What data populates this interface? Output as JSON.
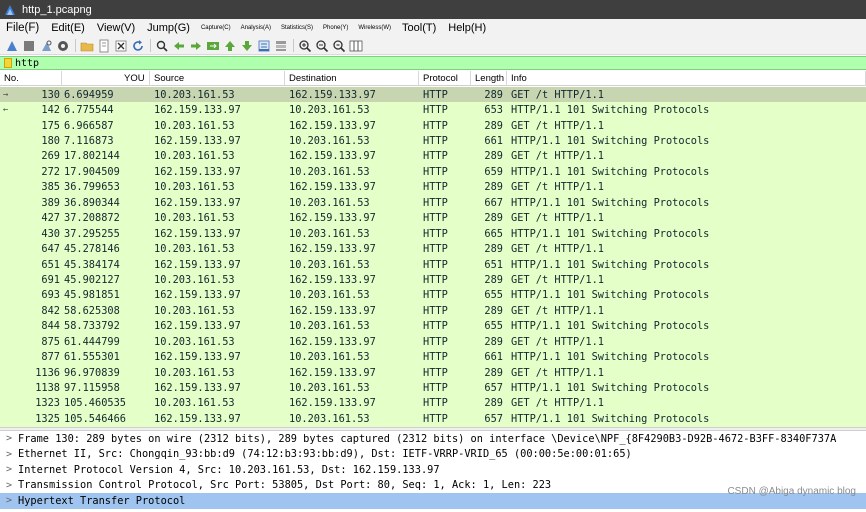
{
  "window": {
    "title": "http_1.pcapng"
  },
  "menu": {
    "items": [
      {
        "label": "File(F)",
        "size": "big"
      },
      {
        "label": "Edit(E)",
        "size": "normal"
      },
      {
        "label": "View(V)",
        "size": "normal"
      },
      {
        "label": "Jump(G)",
        "size": "normal"
      },
      {
        "label": "Capture(C)",
        "size": "small"
      },
      {
        "label": "Analysis(A)",
        "size": "small"
      },
      {
        "label": "Statistics(S)",
        "size": "small"
      },
      {
        "label": "Phone(Y)",
        "size": "small"
      },
      {
        "label": "Wireless(W)",
        "size": "small"
      },
      {
        "label": "Tool(T)",
        "size": "normal"
      },
      {
        "label": "Help(H)",
        "size": "normal"
      }
    ]
  },
  "toolbar": {
    "buttons": [
      "shark-fin-start-icon",
      "stop-icon",
      "restart-icon",
      "options-gear-icon",
      "sep",
      "open-folder-icon",
      "file-icon",
      "close-file-icon",
      "reload-icon",
      "sep",
      "find-icon",
      "go-back-icon",
      "go-forward-icon",
      "go-to-packet-icon",
      "first-packet-icon",
      "last-packet-icon",
      "autoscroll-icon",
      "colorize-icon",
      "sep",
      "zoom-in-icon",
      "zoom-out-icon",
      "zoom-normal-icon",
      "resize-columns-icon"
    ]
  },
  "filter": {
    "value": "http"
  },
  "columns": [
    "No.",
    "YOU",
    "Source",
    "Destination",
    "Protocol",
    "Length",
    "Info"
  ],
  "packets": [
    {
      "no": "130",
      "time": "6.694959",
      "src": "10.203.161.53",
      "dst": "162.159.133.97",
      "proto": "HTTP",
      "len": "289",
      "info": "GET /t HTTP/1.1",
      "arrow": "→"
    },
    {
      "no": "142",
      "time": "6.775544",
      "src": "162.159.133.97",
      "dst": "10.203.161.53",
      "proto": "HTTP",
      "len": "653",
      "info": "HTTP/1.1 101 Switching Protocols",
      "arrow": "←"
    },
    {
      "no": "175",
      "time": "6.966587",
      "src": "10.203.161.53",
      "dst": "162.159.133.97",
      "proto": "HTTP",
      "len": "289",
      "info": "GET /t HTTP/1.1",
      "arrow": ""
    },
    {
      "no": "180",
      "time": "7.116873",
      "src": "162.159.133.97",
      "dst": "10.203.161.53",
      "proto": "HTTP",
      "len": "661",
      "info": "HTTP/1.1 101 Switching Protocols",
      "arrow": ""
    },
    {
      "no": "269",
      "time": "17.802144",
      "src": "10.203.161.53",
      "dst": "162.159.133.97",
      "proto": "HTTP",
      "len": "289",
      "info": "GET /t HTTP/1.1",
      "arrow": ""
    },
    {
      "no": "272",
      "time": "17.904509",
      "src": "162.159.133.97",
      "dst": "10.203.161.53",
      "proto": "HTTP",
      "len": "659",
      "info": "HTTP/1.1 101 Switching Protocols",
      "arrow": ""
    },
    {
      "no": "385",
      "time": "36.799653",
      "src": "10.203.161.53",
      "dst": "162.159.133.97",
      "proto": "HTTP",
      "len": "289",
      "info": "GET /t HTTP/1.1",
      "arrow": ""
    },
    {
      "no": "389",
      "time": "36.890344",
      "src": "162.159.133.97",
      "dst": "10.203.161.53",
      "proto": "HTTP",
      "len": "667",
      "info": "HTTP/1.1 101 Switching Protocols",
      "arrow": ""
    },
    {
      "no": "427",
      "time": "37.208872",
      "src": "10.203.161.53",
      "dst": "162.159.133.97",
      "proto": "HTTP",
      "len": "289",
      "info": "GET /t HTTP/1.1",
      "arrow": ""
    },
    {
      "no": "430",
      "time": "37.295255",
      "src": "162.159.133.97",
      "dst": "10.203.161.53",
      "proto": "HTTP",
      "len": "665",
      "info": "HTTP/1.1 101 Switching Protocols",
      "arrow": ""
    },
    {
      "no": "647",
      "time": "45.278146",
      "src": "10.203.161.53",
      "dst": "162.159.133.97",
      "proto": "HTTP",
      "len": "289",
      "info": "GET /t HTTP/1.1",
      "arrow": ""
    },
    {
      "no": "651",
      "time": "45.384174",
      "src": "162.159.133.97",
      "dst": "10.203.161.53",
      "proto": "HTTP",
      "len": "651",
      "info": "HTTP/1.1 101 Switching Protocols",
      "arrow": ""
    },
    {
      "no": "691",
      "time": "45.902127",
      "src": "10.203.161.53",
      "dst": "162.159.133.97",
      "proto": "HTTP",
      "len": "289",
      "info": "GET /t HTTP/1.1",
      "arrow": ""
    },
    {
      "no": "693",
      "time": "45.981851",
      "src": "162.159.133.97",
      "dst": "10.203.161.53",
      "proto": "HTTP",
      "len": "655",
      "info": "HTTP/1.1 101 Switching Protocols",
      "arrow": ""
    },
    {
      "no": "842",
      "time": "58.625308",
      "src": "10.203.161.53",
      "dst": "162.159.133.97",
      "proto": "HTTP",
      "len": "289",
      "info": "GET /t HTTP/1.1",
      "arrow": ""
    },
    {
      "no": "844",
      "time": "58.733792",
      "src": "162.159.133.97",
      "dst": "10.203.161.53",
      "proto": "HTTP",
      "len": "655",
      "info": "HTTP/1.1 101 Switching Protocols",
      "arrow": ""
    },
    {
      "no": "875",
      "time": "61.444799",
      "src": "10.203.161.53",
      "dst": "162.159.133.97",
      "proto": "HTTP",
      "len": "289",
      "info": "GET /t HTTP/1.1",
      "arrow": ""
    },
    {
      "no": "877",
      "time": "61.555301",
      "src": "162.159.133.97",
      "dst": "10.203.161.53",
      "proto": "HTTP",
      "len": "661",
      "info": "HTTP/1.1 101 Switching Protocols",
      "arrow": ""
    },
    {
      "no": "1136",
      "time": "96.970839",
      "src": "10.203.161.53",
      "dst": "162.159.133.97",
      "proto": "HTTP",
      "len": "289",
      "info": "GET /t HTTP/1.1",
      "arrow": ""
    },
    {
      "no": "1138",
      "time": "97.115958",
      "src": "162.159.133.97",
      "dst": "10.203.161.53",
      "proto": "HTTP",
      "len": "657",
      "info": "HTTP/1.1 101 Switching Protocols",
      "arrow": ""
    },
    {
      "no": "1323",
      "time": "105.460535",
      "src": "10.203.161.53",
      "dst": "162.159.133.97",
      "proto": "HTTP",
      "len": "289",
      "info": "GET /t HTTP/1.1",
      "arrow": ""
    },
    {
      "no": "1325",
      "time": "105.546466",
      "src": "162.159.133.97",
      "dst": "10.203.161.53",
      "proto": "HTTP",
      "len": "657",
      "info": "HTTP/1.1 101 Switching Protocols",
      "arrow": ""
    }
  ],
  "selected_packet_index": 0,
  "details": [
    {
      "text": "Frame 130: 289 bytes on wire (2312 bits), 289 bytes captured (2312 bits) on interface \\Device\\NPF_{8F4290B3-D92B-4672-B3FF-8340F737A",
      "selected": false
    },
    {
      "text": "Ethernet II, Src: Chongqin_93:bb:d9 (74:12:b3:93:bb:d9), Dst: IETF-VRRP-VRID_65 (00:00:5e:00:01:65)",
      "selected": false
    },
    {
      "text": "Internet Protocol Version 4, Src: 10.203.161.53, Dst: 162.159.133.97",
      "selected": false
    },
    {
      "text": "Transmission Control Protocol, Src Port: 53805, Dst Port: 80, Seq: 1, Ack: 1, Len: 223",
      "selected": false
    },
    {
      "text": "Hypertext Transfer Protocol",
      "selected": true
    }
  ],
  "expander_glyph": ">",
  "watermark": "CSDN @Abiga dynamic blog"
}
